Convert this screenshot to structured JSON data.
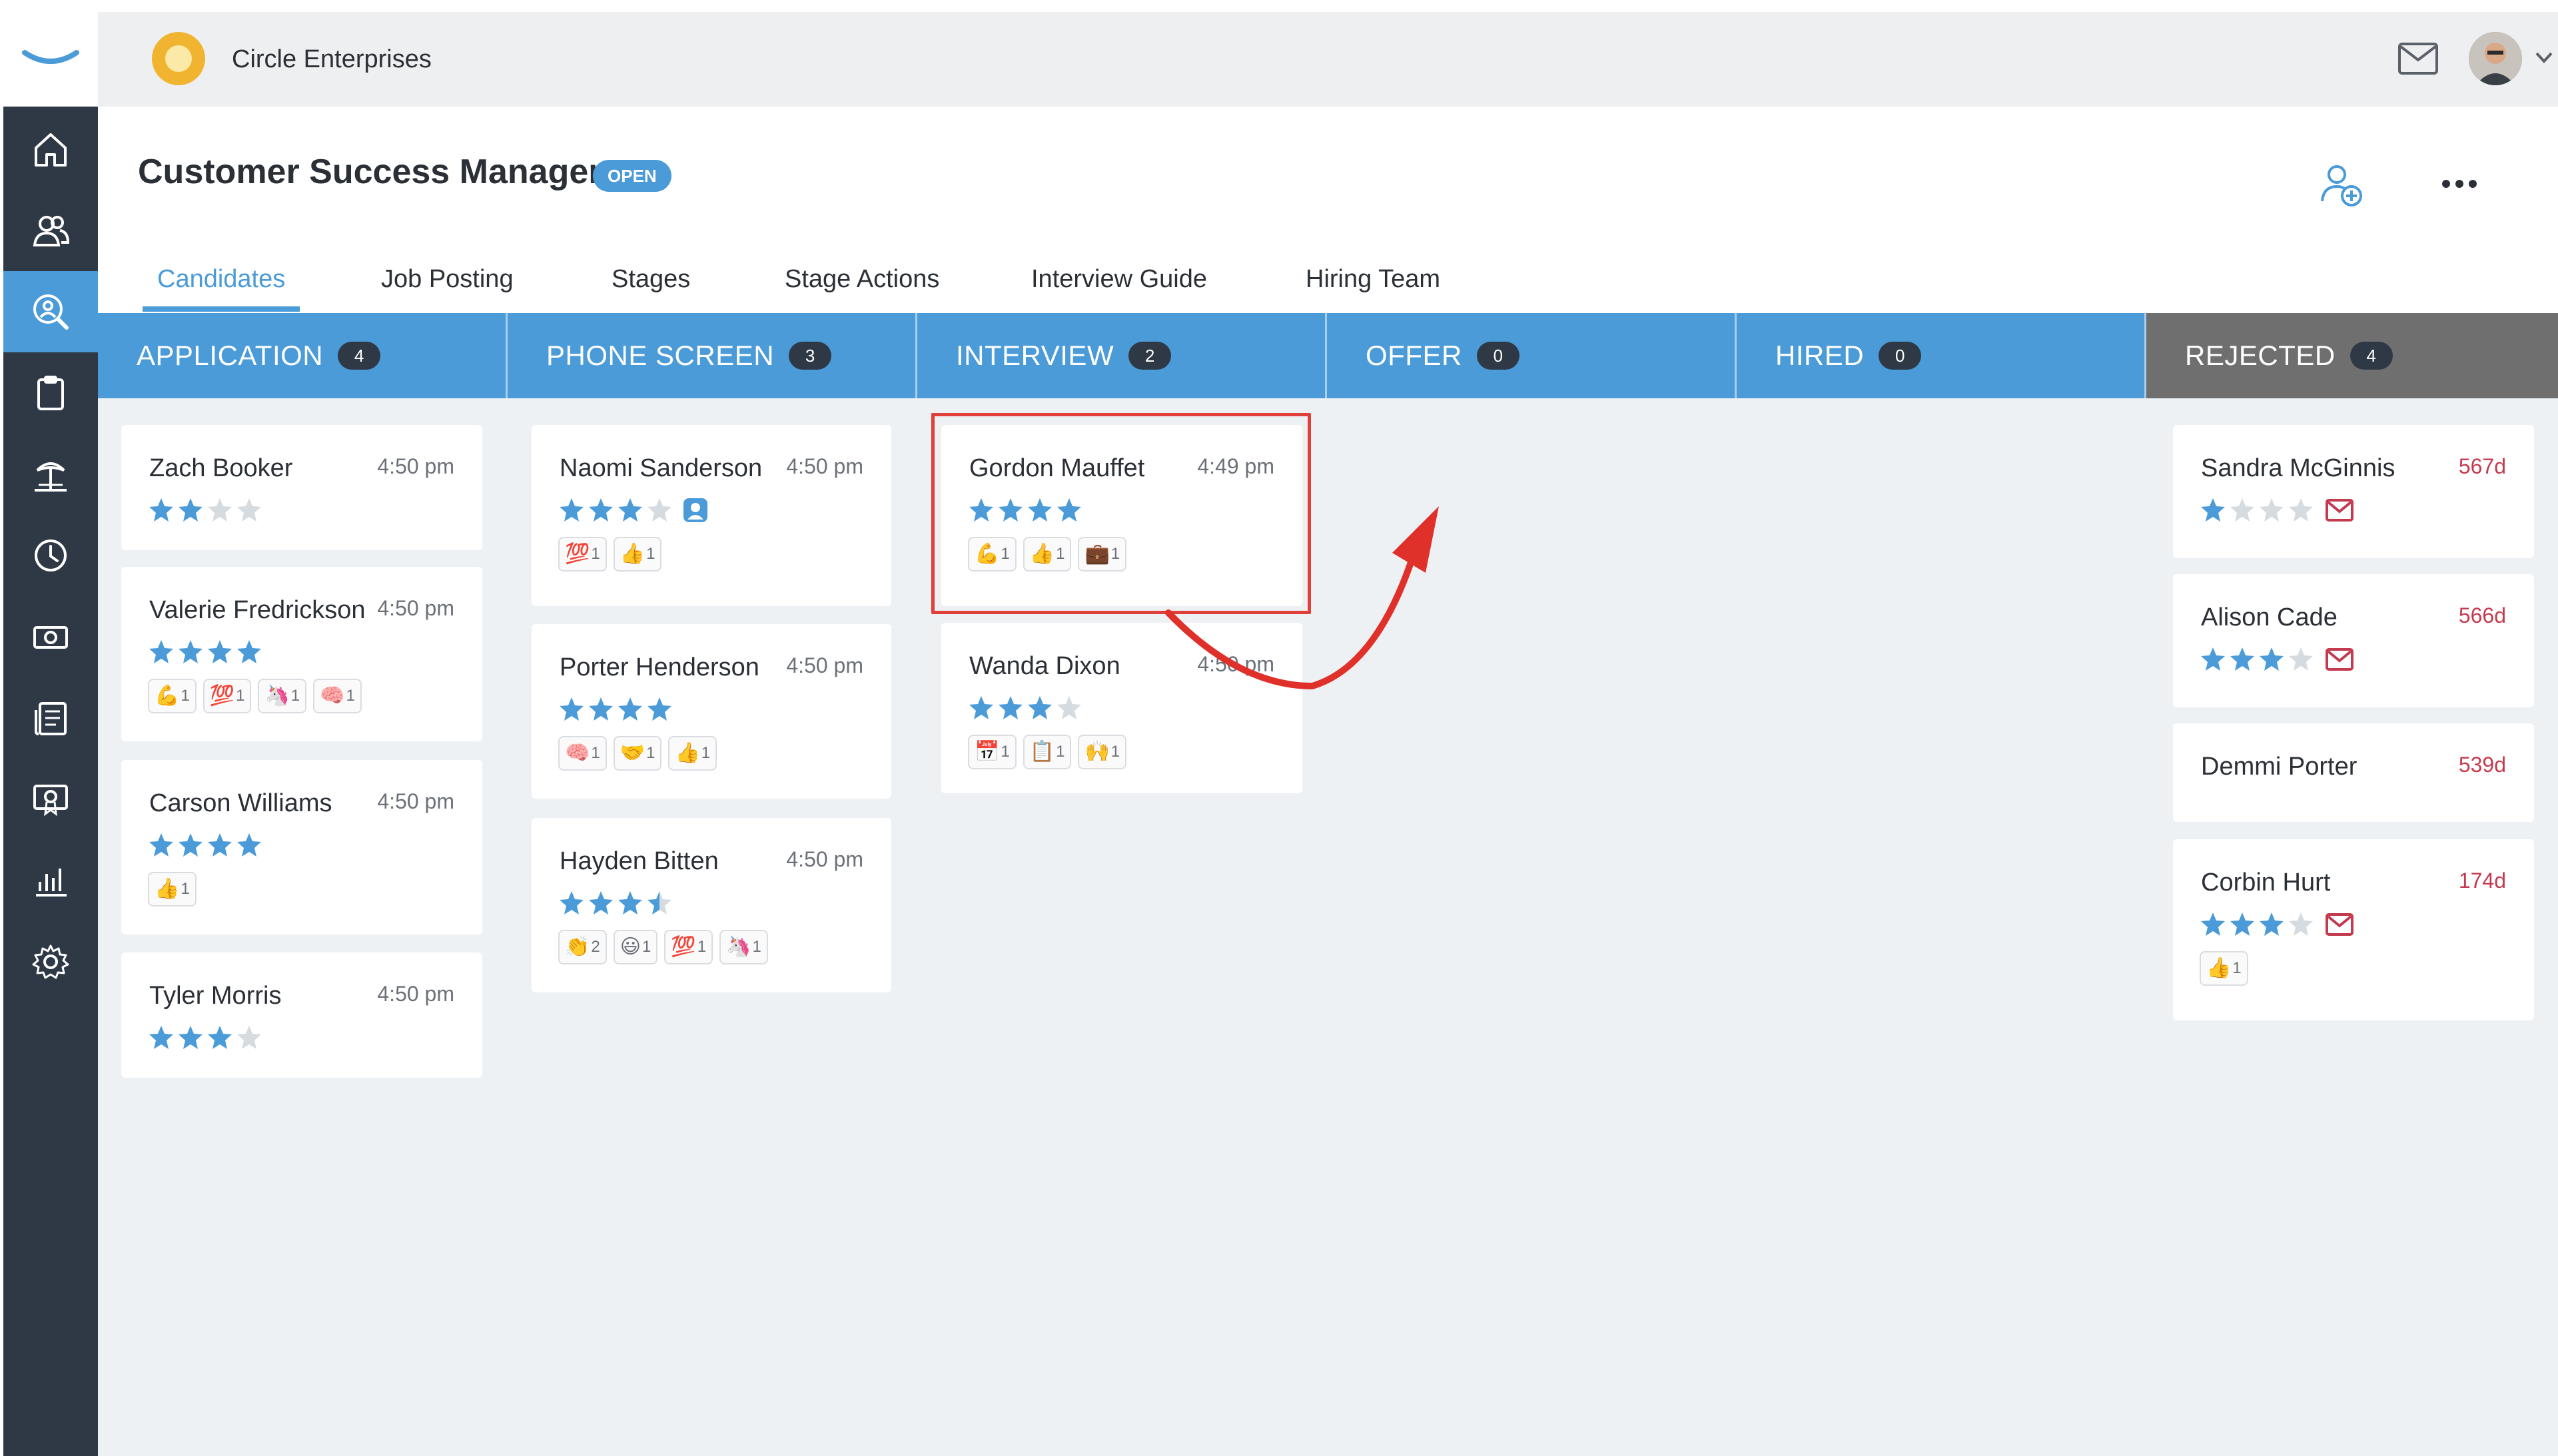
{
  "app": {
    "company_name": "Circle Enterprises",
    "brand_color": "#4a9bd8",
    "nav_items": [
      "home-icon",
      "people-icon",
      "candidate-search-icon",
      "clipboard-icon",
      "island-icon",
      "clock-icon",
      "money-icon",
      "newspaper-icon",
      "certificate-icon",
      "bar-chart-icon",
      "gear-icon"
    ],
    "active_nav": "candidate-search-icon"
  },
  "header": {
    "title": "Customer Success Manager",
    "status": "OPEN"
  },
  "tabs": [
    {
      "label": "Candidates",
      "active": true
    },
    {
      "label": "Job Posting",
      "active": false
    },
    {
      "label": "Stages",
      "active": false
    },
    {
      "label": "Stage Actions",
      "active": false
    },
    {
      "label": "Interview Guide",
      "active": false
    },
    {
      "label": "Hiring Team",
      "active": false
    }
  ],
  "columns": [
    {
      "title": "APPLICATION",
      "count": "4",
      "color": "#4a9bd8"
    },
    {
      "title": "PHONE SCREEN",
      "count": "3",
      "color": "#4a9bd8"
    },
    {
      "title": "INTERVIEW",
      "count": "2",
      "color": "#4a9bd8"
    },
    {
      "title": "OFFER",
      "count": "0",
      "color": "#4a9bd8"
    },
    {
      "title": "HIRED",
      "count": "0",
      "color": "#4a9bd8"
    },
    {
      "title": "REJECTED",
      "count": "4",
      "color": "#6f6f6f"
    }
  ],
  "cards": {
    "application": [
      {
        "name": "Zach Booker",
        "time": "4:50 pm",
        "rating": 2,
        "reactions": []
      },
      {
        "name": "Valerie Fredrickson",
        "time": "4:50 pm",
        "rating": 4,
        "reactions": [
          {
            "emoji": "💪",
            "count": "1"
          },
          {
            "emoji": "💯",
            "count": "1"
          },
          {
            "emoji": "🦄",
            "count": "1"
          },
          {
            "emoji": "🧠",
            "count": "1"
          }
        ]
      },
      {
        "name": "Carson Williams",
        "time": "4:50 pm",
        "rating": 4,
        "reactions": [
          {
            "emoji": "👍",
            "count": "1"
          }
        ]
      },
      {
        "name": "Tyler Morris",
        "time": "4:50 pm",
        "rating": 3,
        "reactions": []
      }
    ],
    "phone_screen": [
      {
        "name": "Naomi Sanderson",
        "time": "4:50 pm",
        "rating": 3,
        "reactions": [
          {
            "emoji": "💯",
            "count": "1"
          },
          {
            "emoji": "👍",
            "count": "1"
          }
        ]
      },
      {
        "name": "Porter Henderson",
        "time": "4:50 pm",
        "rating": 4,
        "reactions": [
          {
            "emoji": "🧠",
            "count": "1"
          },
          {
            "emoji": "🤝",
            "count": "1"
          },
          {
            "emoji": "👍",
            "count": "1"
          }
        ]
      },
      {
        "name": "Hayden Bitten",
        "time": "4:50 pm",
        "rating": 3.5,
        "reactions": [
          {
            "emoji": "👏",
            "count": "2"
          },
          {
            "emoji": "😃",
            "count": "1"
          },
          {
            "emoji": "💯",
            "count": "1"
          },
          {
            "emoji": "🦄",
            "count": "1"
          }
        ]
      }
    ],
    "interview": [
      {
        "name": "Gordon Mauffet",
        "time": "4:49 pm",
        "rating": 4,
        "reactions": [
          {
            "emoji": "💪",
            "count": "1"
          },
          {
            "emoji": "👍",
            "count": "1"
          },
          {
            "emoji": "💼",
            "count": "1"
          }
        ]
      },
      {
        "name": "Wanda Dixon",
        "time": "4:50 pm",
        "rating": 3,
        "reactions": [
          {
            "emoji": "📅",
            "count": "1"
          },
          {
            "emoji": "📋",
            "count": "1"
          },
          {
            "emoji": "🙌",
            "count": "1"
          }
        ]
      }
    ],
    "rejected": [
      {
        "name": "Sandra McGinnis",
        "time": "567d",
        "rating": 1,
        "reactions": []
      },
      {
        "name": "Alison Cade",
        "time": "566d",
        "rating": 3,
        "reactions": []
      },
      {
        "name": "Demmi Porter",
        "time": "539d",
        "reactions": []
      },
      {
        "name": "Corbin Hurt",
        "time": "174d",
        "rating": 3,
        "reactions": [
          {
            "emoji": "👍",
            "count": "1"
          }
        ]
      }
    ]
  }
}
